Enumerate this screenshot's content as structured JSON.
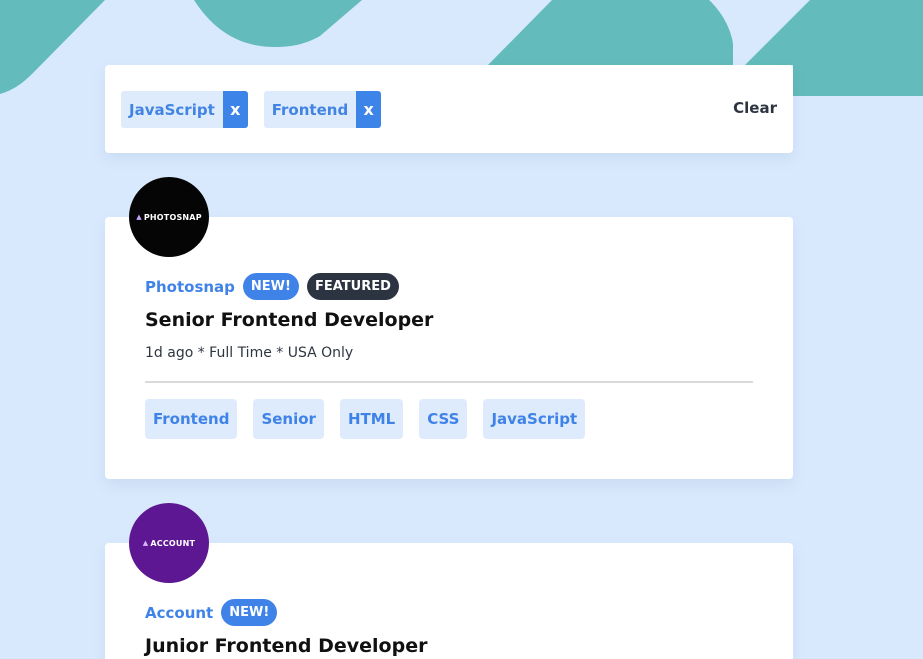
{
  "filters": {
    "active": [
      {
        "label": "JavaScript",
        "remove_label": "x"
      },
      {
        "label": "Frontend",
        "remove_label": "x"
      }
    ],
    "clear_label": "Clear"
  },
  "jobs": [
    {
      "logo_text": "PHOTOSNAP",
      "company": "Photosnap",
      "badges": {
        "new": "NEW!",
        "featured": "FEATURED"
      },
      "title": "Senior Frontend Developer",
      "meta": "1d ago * Full Time * USA Only",
      "tags": [
        "Frontend",
        "Senior",
        "HTML",
        "CSS",
        "JavaScript"
      ]
    },
    {
      "logo_text": "ACCOUNT",
      "company": "Account",
      "badges": {
        "new": "NEW!"
      },
      "title": "Junior Frontend Developer"
    }
  ],
  "colors": {
    "background": "#d9e9fd",
    "accent": "#3f82e8",
    "teal": "#63bbbb",
    "featured": "#2b3440"
  },
  "icons": {
    "remove": "x",
    "logo_mark": "triangle"
  }
}
